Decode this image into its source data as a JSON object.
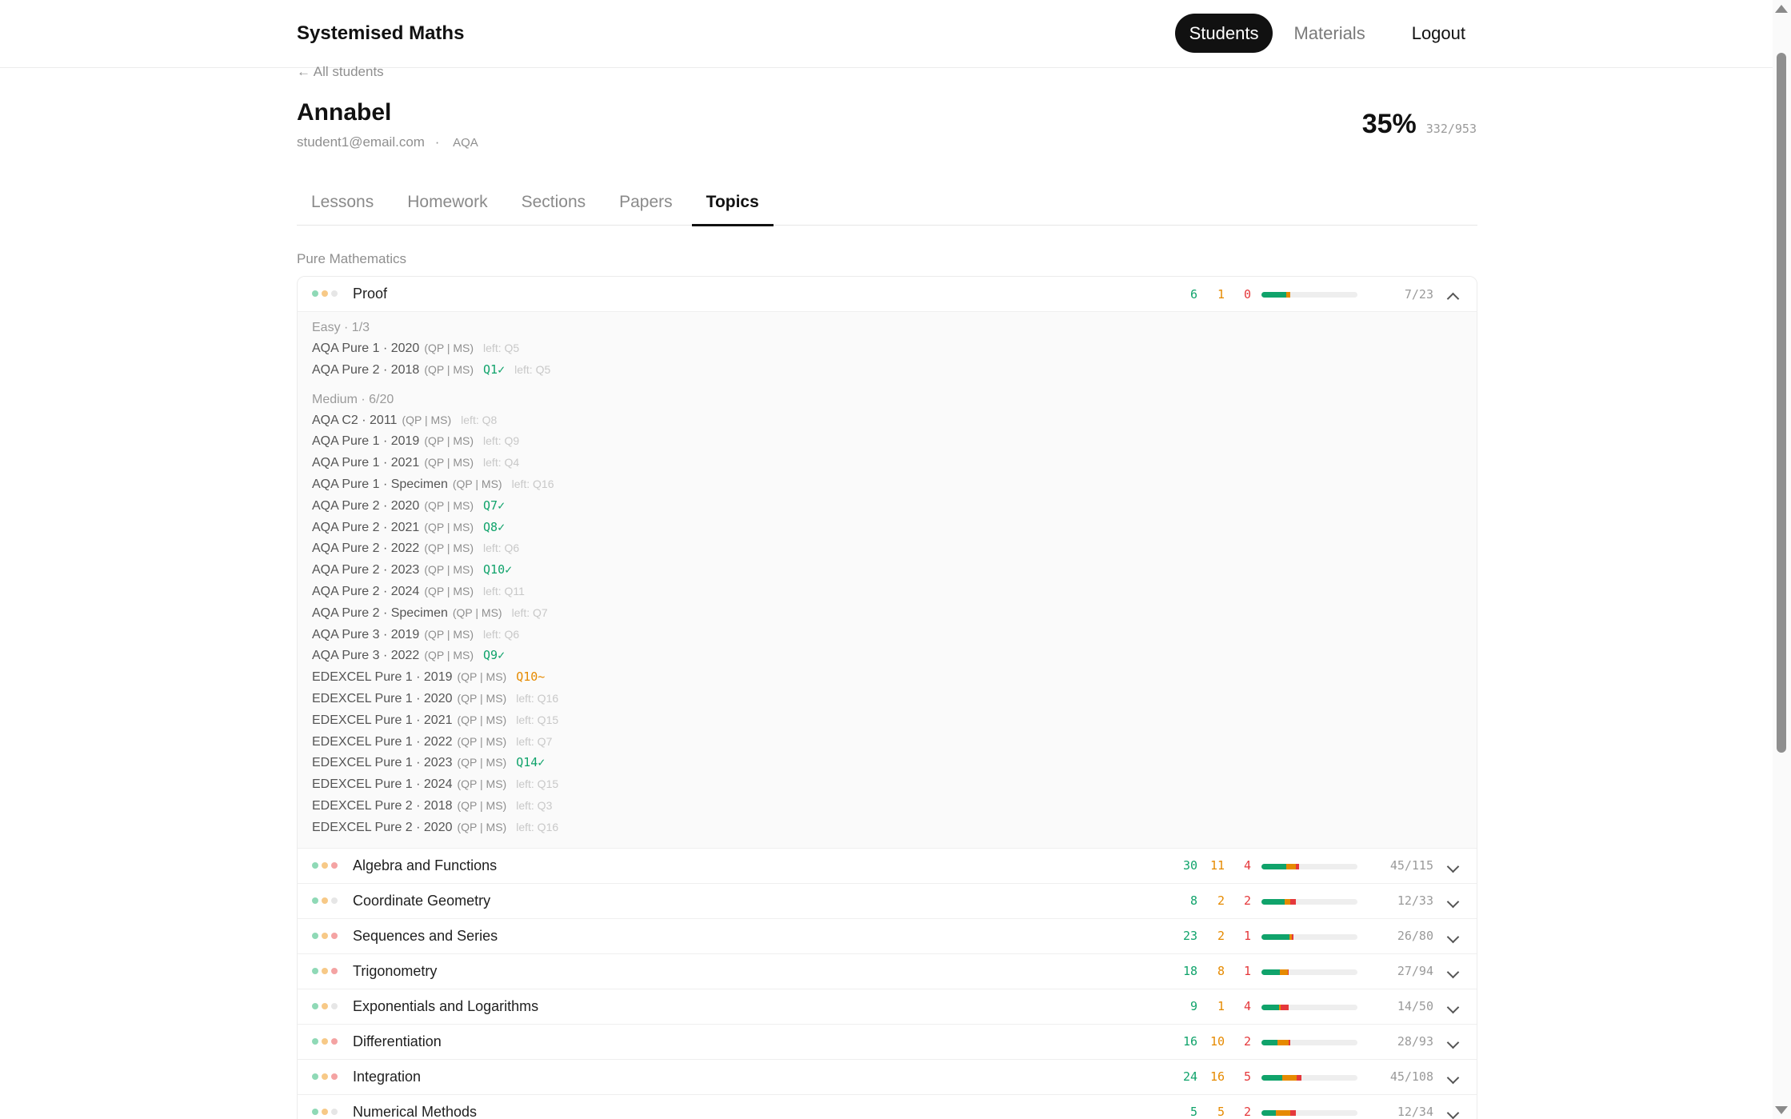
{
  "header": {
    "brand": "Systemised Maths",
    "nav": {
      "students": "Students",
      "materials": "Materials",
      "logout": "Logout"
    }
  },
  "student": {
    "back_link": "← All students",
    "name": "Annabel",
    "email": "student1@email.com",
    "separator": "·",
    "board": "AQA",
    "overall_percent": "35%",
    "overall_fraction": "332/953"
  },
  "tabs": [
    "Lessons",
    "Homework",
    "Sections",
    "Papers",
    "Topics"
  ],
  "active_tab": "Topics",
  "section_label": "Pure Mathematics",
  "colors": {
    "green": "#10a36b",
    "orange": "#e68a00",
    "red": "#e5383b",
    "track": "#eeeeee"
  },
  "links_label": "(QP | MS)",
  "topics": [
    {
      "name": "Proof",
      "expanded": true,
      "green": "6",
      "orange": "1",
      "red": "0",
      "fraction": "7/23",
      "dots": [
        "#8fd9b6",
        "#f7c987",
        "#e6e6e6"
      ],
      "bar": {
        "green": 0.26,
        "orange": 0.04,
        "red": 0.0
      },
      "groups": [
        {
          "title": "Easy · 1/3",
          "papers": [
            {
              "name": "AQA Pure 1 · 2020",
              "status": "left",
              "label": "left: Q5"
            },
            {
              "name": "AQA Pure 2 · 2018",
              "status": "done",
              "label": "Q1✓",
              "extra": "left: Q5"
            }
          ]
        },
        {
          "title": "Medium · 6/20",
          "papers": [
            {
              "name": "AQA C2 · 2011",
              "status": "left",
              "label": "left: Q8"
            },
            {
              "name": "AQA Pure 1 · 2019",
              "status": "left",
              "label": "left: Q9"
            },
            {
              "name": "AQA Pure 1 · 2021",
              "status": "left",
              "label": "left: Q4"
            },
            {
              "name": "AQA Pure 1 · Specimen",
              "status": "left",
              "label": "left: Q16"
            },
            {
              "name": "AQA Pure 2 · 2020",
              "status": "done",
              "label": "Q7✓"
            },
            {
              "name": "AQA Pure 2 · 2021",
              "status": "done",
              "label": "Q8✓"
            },
            {
              "name": "AQA Pure 2 · 2022",
              "status": "left",
              "label": "left: Q6"
            },
            {
              "name": "AQA Pure 2 · 2023",
              "status": "done",
              "label": "Q10✓"
            },
            {
              "name": "AQA Pure 2 · 2024",
              "status": "left",
              "label": "left: Q11"
            },
            {
              "name": "AQA Pure 2 · Specimen",
              "status": "left",
              "label": "left: Q7"
            },
            {
              "name": "AQA Pure 3 · 2019",
              "status": "left",
              "label": "left: Q6"
            },
            {
              "name": "AQA Pure 3 · 2022",
              "status": "done",
              "label": "Q9✓"
            },
            {
              "name": "EDEXCEL Pure 1 · 2019",
              "status": "partial",
              "label": "Q10~"
            },
            {
              "name": "EDEXCEL Pure 1 · 2020",
              "status": "left",
              "label": "left: Q16"
            },
            {
              "name": "EDEXCEL Pure 1 · 2021",
              "status": "left",
              "label": "left: Q15"
            },
            {
              "name": "EDEXCEL Pure 1 · 2022",
              "status": "left",
              "label": "left: Q7"
            },
            {
              "name": "EDEXCEL Pure 1 · 2023",
              "status": "done",
              "label": "Q14✓"
            },
            {
              "name": "EDEXCEL Pure 1 · 2024",
              "status": "left",
              "label": "left: Q15"
            },
            {
              "name": "EDEXCEL Pure 2 · 2018",
              "status": "left",
              "label": "left: Q3"
            },
            {
              "name": "EDEXCEL Pure 2 · 2020",
              "status": "left",
              "label": "left: Q16"
            }
          ]
        }
      ]
    },
    {
      "name": "Algebra and Functions",
      "expanded": false,
      "green": "30",
      "orange": "11",
      "red": "4",
      "fraction": "45/115",
      "dots": [
        "#8fd9b6",
        "#f7c987",
        "#f4a3a3"
      ],
      "bar": {
        "green": 0.26,
        "orange": 0.1,
        "red": 0.035
      }
    },
    {
      "name": "Coordinate Geometry",
      "expanded": false,
      "green": "8",
      "orange": "2",
      "red": "2",
      "fraction": "12/33",
      "dots": [
        "#8fd9b6",
        "#f7c987",
        "#e6e6e6"
      ],
      "bar": {
        "green": 0.24,
        "orange": 0.06,
        "red": 0.06
      }
    },
    {
      "name": "Sequences and Series",
      "expanded": false,
      "green": "23",
      "orange": "2",
      "red": "1",
      "fraction": "26/80",
      "dots": [
        "#8fd9b6",
        "#f7c987",
        "#f4a3a3"
      ],
      "bar": {
        "green": 0.29,
        "orange": 0.025,
        "red": 0.015
      }
    },
    {
      "name": "Trigonometry",
      "expanded": false,
      "green": "18",
      "orange": "8",
      "red": "1",
      "fraction": "27/94",
      "dots": [
        "#8fd9b6",
        "#f7c987",
        "#f4a3a3"
      ],
      "bar": {
        "green": 0.19,
        "orange": 0.085,
        "red": 0.012
      }
    },
    {
      "name": "Exponentials and Logarithms",
      "expanded": false,
      "green": "9",
      "orange": "1",
      "red": "4",
      "fraction": "14/50",
      "dots": [
        "#8fd9b6",
        "#f7c987",
        "#e6e6e6"
      ],
      "bar": {
        "green": 0.18,
        "orange": 0.02,
        "red": 0.08
      }
    },
    {
      "name": "Differentiation",
      "expanded": false,
      "green": "16",
      "orange": "10",
      "red": "2",
      "fraction": "28/93",
      "dots": [
        "#8fd9b6",
        "#f7c987",
        "#f4a3a3"
      ],
      "bar": {
        "green": 0.17,
        "orange": 0.11,
        "red": 0.02
      }
    },
    {
      "name": "Integration",
      "expanded": false,
      "green": "24",
      "orange": "16",
      "red": "5",
      "fraction": "45/108",
      "dots": [
        "#8fd9b6",
        "#f7c987",
        "#f4a3a3"
      ],
      "bar": {
        "green": 0.22,
        "orange": 0.15,
        "red": 0.05
      }
    },
    {
      "name": "Numerical Methods",
      "expanded": false,
      "green": "5",
      "orange": "5",
      "red": "2",
      "fraction": "12/34",
      "dots": [
        "#8fd9b6",
        "#f7c987",
        "#e6e6e6"
      ],
      "bar": {
        "green": 0.15,
        "orange": 0.15,
        "red": 0.06
      }
    }
  ]
}
